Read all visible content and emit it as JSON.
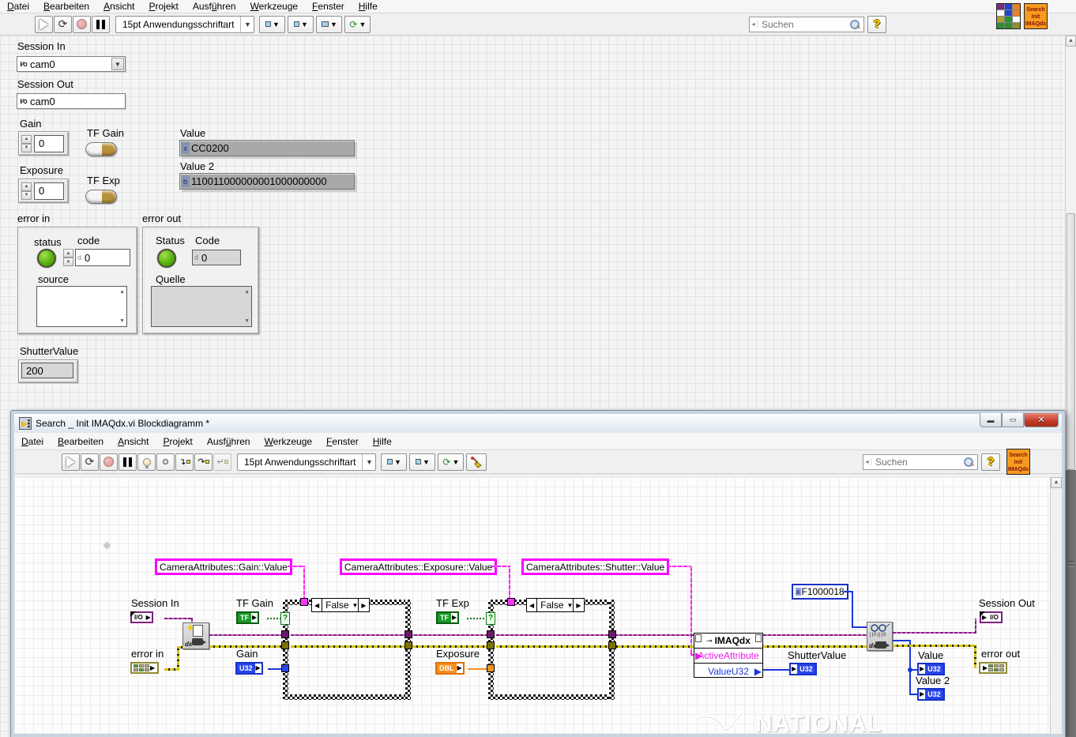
{
  "chrome": {
    "menu": [
      {
        "t": "Datei",
        "u": 0
      },
      {
        "t": "Bearbeiten",
        "u": 0
      },
      {
        "t": "Ansicht",
        "u": 0
      },
      {
        "t": "Projekt",
        "u": 0
      },
      {
        "t": "Ausführen",
        "u": 4
      },
      {
        "t": "Werkzeuge",
        "u": 0
      },
      {
        "t": "Fenster",
        "u": 0
      },
      {
        "t": "Hilfe",
        "u": 0
      }
    ],
    "toolbar": {
      "font": "15pt Anwendungsschriftart"
    },
    "search_placeholder": "Suchen",
    "help_label": "?",
    "vi_icon_lines": [
      "Search",
      "Init",
      "IMAQdx"
    ],
    "connector_colors": [
      "#7a2e7a",
      "#2244cc",
      "#ee7f22",
      "#ffffff",
      "#2244cc",
      "#ee7f22",
      "#a8a030",
      "#2e8f2e",
      "#ffffff",
      "#2e8f2e",
      "#2e8f2e",
      "#8f8f30"
    ]
  },
  "fp": {
    "session_in": {
      "label": "Session In",
      "glyph_top": "I",
      "glyph_bottom": "O",
      "value": "cam0"
    },
    "session_out": {
      "label": "Session Out",
      "glyph_top": "I",
      "glyph_bottom": "O",
      "value": "cam0"
    },
    "gain": {
      "label": "Gain",
      "value": "0"
    },
    "tf_gain": {
      "label": "TF Gain"
    },
    "exposure": {
      "label": "Exposure",
      "value": "0"
    },
    "tf_exp": {
      "label": "TF Exp"
    },
    "value": {
      "label": "Value",
      "radix": "x",
      "value": "CC0200"
    },
    "value2": {
      "label": "Value 2",
      "radix": "b",
      "value": "110011000000001000000000"
    },
    "error_in": {
      "label": "error in",
      "status_label": "status",
      "code_label": "code",
      "code_radix": "d",
      "code_value": "0",
      "source_label": "source"
    },
    "error_out": {
      "label": "error out",
      "status_label": "Status",
      "code_label": "Code",
      "code_radix": "d",
      "code_value": "0",
      "source_label": "Quelle"
    },
    "shutter": {
      "label": "ShutterValue",
      "value": "200"
    }
  },
  "bd": {
    "title": "Search _ Init IMAQdx.vi Blockdiagramm *",
    "label_gain": "CameraAttributes::Gain::Value",
    "label_exposure": "CameraAttributes::Exposure::Value",
    "label_shutter": "CameraAttributes::Shutter::Value",
    "case1_selector": "False",
    "case2_selector": "False",
    "terminals": {
      "session_in": {
        "label": "Session In",
        "glyph": "I/O"
      },
      "tf_gain": {
        "label": "TF Gain",
        "glyph": "TF"
      },
      "error_in": {
        "label": "error in"
      },
      "gain": {
        "label": "Gain",
        "glyph": "U32"
      },
      "tf_exp": {
        "label": "TF Exp",
        "glyph": "TF"
      },
      "exposure": {
        "label": "Exposure",
        "glyph": "DBL"
      },
      "shutter": {
        "label": "ShutterValue",
        "glyph": "U32"
      },
      "session_out": {
        "label": "Session Out",
        "glyph": "I/O"
      },
      "value": {
        "label": "Value",
        "glyph": "U32"
      },
      "value2": {
        "label": "Value 2",
        "glyph": "U32"
      },
      "error_out": {
        "label": "error out"
      }
    },
    "constant": {
      "radix": "x",
      "value": "F1000018"
    },
    "prop_node": {
      "header": "IMAQdx",
      "row1": "ActiveAttribute",
      "row2": "ValueU32"
    },
    "watermark": "NATIONAL",
    "case_tunnel_question": "?"
  },
  "colors": {
    "accent_pink": "#fb00fb",
    "session_purple": "#7c2180",
    "error_olive": "#8f8a30",
    "bool_green": "#0a5c10",
    "int_blue": "#1531c8",
    "dbl_orange": "#e07000",
    "led_green": "#55b10c",
    "close_red": "#c23b27",
    "vi_icon_orange": "#f89a20"
  }
}
